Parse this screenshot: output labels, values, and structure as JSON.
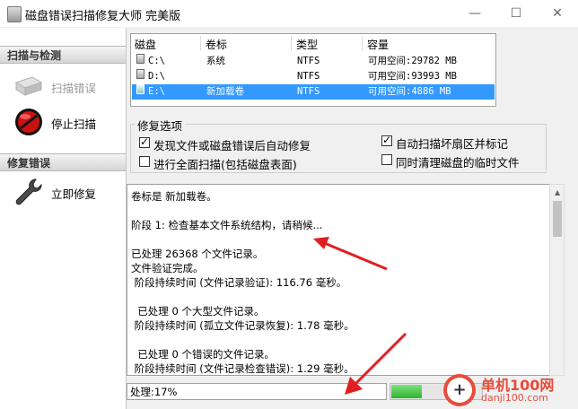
{
  "window": {
    "title": "磁盘错误扫描修复大师 完美版",
    "minimize": "—",
    "maximize": "☐",
    "close": "✕"
  },
  "sidebar": {
    "scan_section": "扫描与检测",
    "scan_errors": "扫描错误",
    "stop_scan": "停止扫描",
    "repair_section": "修复错误",
    "repair_now": "立即修复"
  },
  "drives": {
    "columns": [
      "磁盘",
      "卷标",
      "类型",
      "容量"
    ],
    "rows": [
      {
        "drive": "C:\\",
        "label": "系统",
        "type": "NTFS",
        "capacity": "可用空间:29782 MB",
        "selected": false
      },
      {
        "drive": "D:\\",
        "label": "",
        "type": "NTFS",
        "capacity": "可用空间:93993 MB",
        "selected": false
      },
      {
        "drive": "E:\\",
        "label": "新加载卷",
        "type": "NTFS",
        "capacity": "可用空间:4886 MB",
        "selected": true
      }
    ]
  },
  "repair_options": {
    "title": "修复选项",
    "auto_repair": {
      "label": "发现文件或磁盘错误后自动修复",
      "checked": true
    },
    "full_scan": {
      "label": "进行全面扫描(包括磁盘表面)",
      "checked": false
    },
    "mark_bad": {
      "label": "自动扫描坏扇区并标记",
      "checked": true
    },
    "clean_temp": {
      "label": "同时清理磁盘的临时文件",
      "checked": false
    }
  },
  "log": {
    "lines": [
      "卷标是 新加载卷。",
      "",
      "阶段 1: 检查基本文件系统结构，请稍候...",
      "",
      "已处理 26368 个文件记录。",
      "文件验证完成。",
      " 阶段持续时间 (文件记录验证): 116.76 毫秒。",
      "",
      "  已处理 0 个大型文件记录。",
      " 阶段持续时间 (孤立文件记录恢复): 1.78 毫秒。",
      "",
      "  已处理 0 个错误的文件记录。",
      " 阶段持续时间 (文件记录检查错误): 1.29 毫秒。"
    ]
  },
  "status": {
    "text": "处理:17%",
    "progress": 0.17
  },
  "watermark": {
    "plus": "+",
    "name": "单机100网",
    "url": "danji100.com"
  },
  "colors": {
    "selection": "#3399ff",
    "progress_green": "#2fb52f",
    "arrow_red": "#e02020",
    "stop_icon_red": "#cc1111"
  }
}
